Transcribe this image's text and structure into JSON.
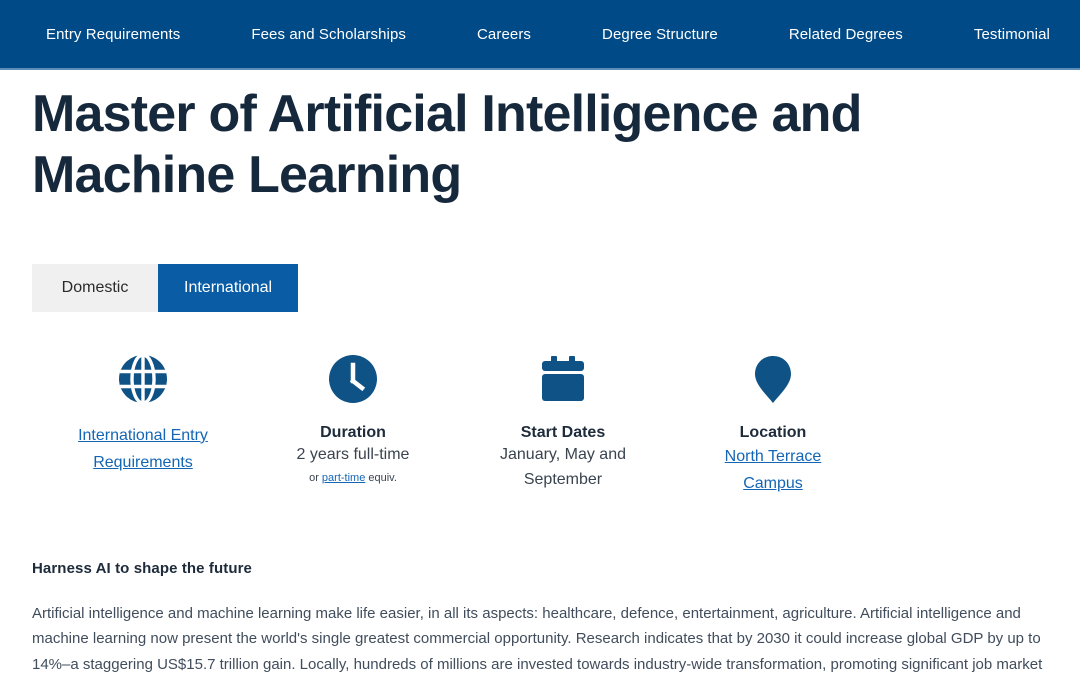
{
  "nav": {
    "items": [
      {
        "label": "Entry Requirements"
      },
      {
        "label": "Fees and Scholarships"
      },
      {
        "label": "Careers"
      },
      {
        "label": "Degree Structure"
      },
      {
        "label": "Related Degrees"
      },
      {
        "label": "Testimonial"
      }
    ]
  },
  "page": {
    "title": "Master of Artificial Intelligence and Machine Learning"
  },
  "tabs": {
    "domestic": "Domestic",
    "international": "International"
  },
  "info": {
    "entry": {
      "icon": "globe-icon",
      "link_line1": "International Entry",
      "link_line2": "Requirements"
    },
    "duration": {
      "icon": "clock-icon",
      "label": "Duration",
      "value": "2 years full-time",
      "sub_prefix": "or ",
      "sub_link": "part-time",
      "sub_suffix": " equiv."
    },
    "start_dates": {
      "icon": "calendar-icon",
      "label": "Start Dates",
      "value_line1": "January, May and",
      "value_line2": "September"
    },
    "location": {
      "icon": "map-pin-icon",
      "label": "Location",
      "link_line1": "North Terrace",
      "link_line2": "Campus"
    }
  },
  "body": {
    "heading": "Harness AI to shape the future",
    "paragraph": "Artificial intelligence and machine learning make life easier, in all its aspects: healthcare, defence, entertainment, agriculture. Artificial intelligence and machine learning now present the world's single greatest commercial opportunity. Research indicates that by 2030 it could increase global GDP by up to 14%–a staggering US$15.7 trillion gain. Locally, hundreds of millions are invested towards industry-wide transformation, promoting significant job market"
  },
  "colors": {
    "nav_background": "#004b87",
    "accent_blue": "#0a5ca4",
    "icon_blue": "#0f5285",
    "link_blue": "#1466b5",
    "title_navy": "#16283c",
    "tab_inactive": "#f0f0f0"
  }
}
